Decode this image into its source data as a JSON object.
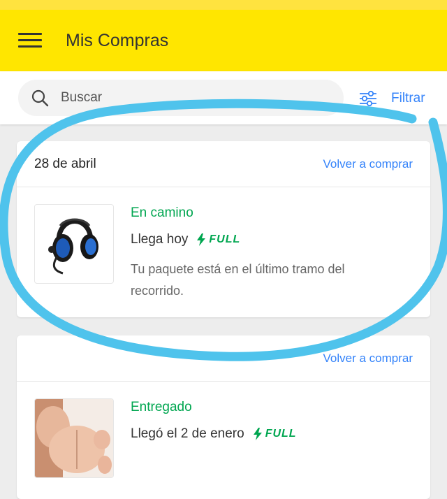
{
  "header": {
    "title": "Mis Compras",
    "menu_icon": "hamburger-menu-icon",
    "background": "#ffe600"
  },
  "search": {
    "placeholder": "Buscar",
    "icon": "search-icon"
  },
  "filter": {
    "label": "Filtrar",
    "icon": "sliders-icon"
  },
  "orders": [
    {
      "date": "28 de abril",
      "rebuy_label": "Volver a comprar",
      "status": "En camino",
      "eta": "Llega hoy",
      "badge": "FULL",
      "description": "Tu paquete está en el último tramo del recorrido.",
      "thumbnail": "headset-image"
    },
    {
      "date": "",
      "rebuy_label": "Volver a comprar",
      "status": "Entregado",
      "eta": "Llegó el 2 de enero",
      "badge": "FULL",
      "thumbnail": "product-image"
    }
  ],
  "colors": {
    "accent": "#3483fa",
    "success": "#00a650",
    "annotation": "#4fc3ec"
  }
}
